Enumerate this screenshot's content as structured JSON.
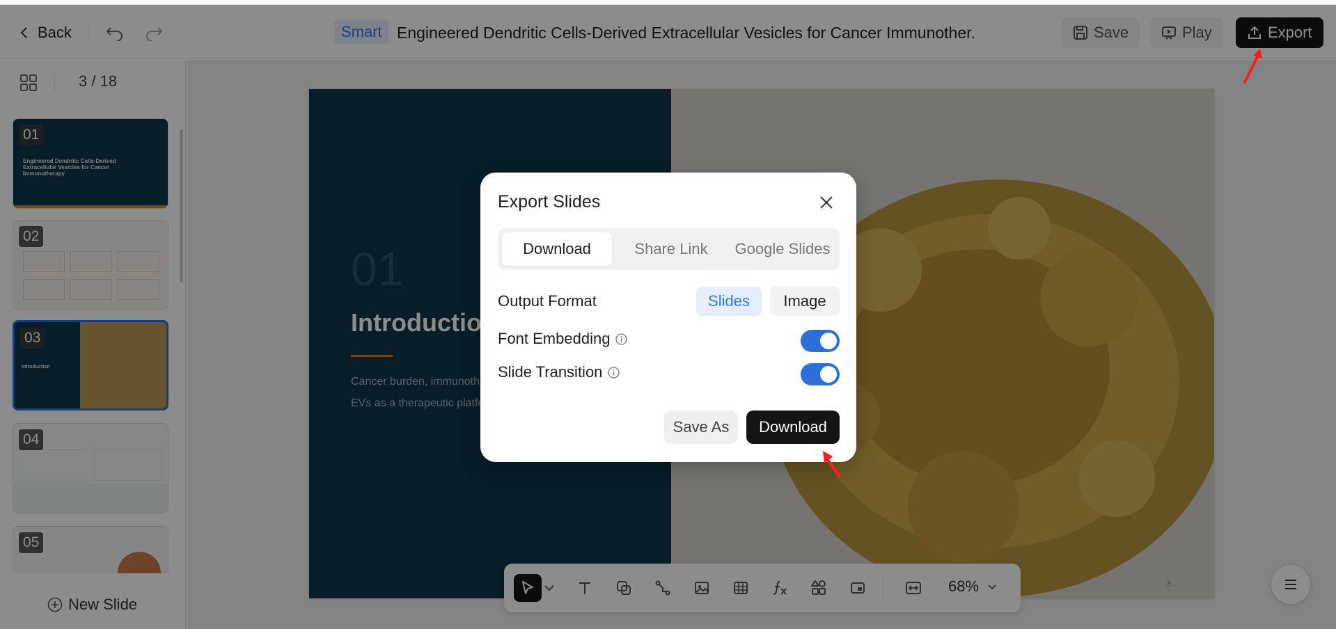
{
  "topbar": {
    "back_label": "Back",
    "smart_label": "Smart",
    "title": "Engineered Dendritic Cells-Derived Extracellular Vesicles for Cancer Immunother...",
    "save_label": "Save",
    "play_label": "Play",
    "export_label": "Export"
  },
  "sidebar": {
    "page_count": "3 / 18",
    "new_slide_label": "New Slide",
    "thumbnails": [
      {
        "num": "01",
        "title": "Engineered Dendritic Cells-Derived Extracellular Vesicles for Cancer Immunotherapy"
      },
      {
        "num": "02"
      },
      {
        "num": "03",
        "title": "Introduction"
      },
      {
        "num": "04"
      },
      {
        "num": "05"
      }
    ]
  },
  "slide": {
    "number": "01",
    "heading": "Introduction",
    "body": "Cancer burden, immunotherapy and the emergence of DC-EVs as a therapeutic platform",
    "page_number": "3"
  },
  "toolbar": {
    "zoom": "68%",
    "tools": [
      "select-icon",
      "text-icon",
      "shape-icon",
      "connector-icon",
      "image-icon",
      "table-icon",
      "formula-icon",
      "components-icon",
      "media-icon",
      "fit-icon"
    ]
  },
  "dialog": {
    "title": "Export Slides",
    "tabs": [
      "Download",
      "Share Link",
      "Google Slides"
    ],
    "active_tab": "Download",
    "output_format_label": "Output Format",
    "format_options": [
      "Slides",
      "Image"
    ],
    "selected_format": "Slides",
    "font_embedding_label": "Font Embedding",
    "font_embedding_on": true,
    "slide_transition_label": "Slide Transition",
    "slide_transition_on": true,
    "save_as_label": "Save As",
    "download_label": "Download"
  },
  "colors": {
    "accent": "#2f7be8",
    "toggle_on": "#2b6fd8",
    "slide_dark": "#0d3647",
    "annotation_arrow": "#ff1a1a"
  }
}
